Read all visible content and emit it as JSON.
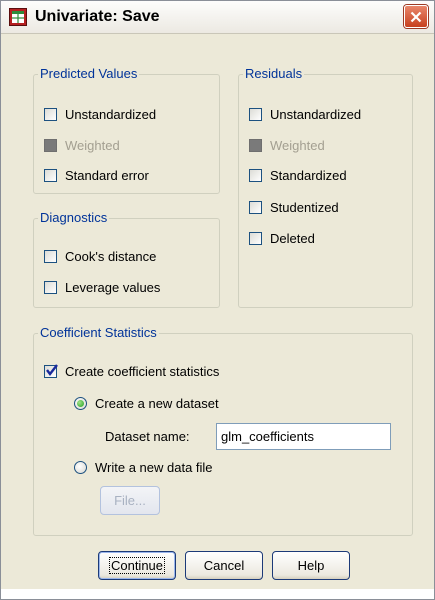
{
  "window": {
    "title": "Univariate: Save",
    "close_icon": "close-icon",
    "app_icon": "spss-table-icon"
  },
  "predicted_values": {
    "legend": "Predicted Values",
    "unstandardized": {
      "label": "Unstandardized",
      "checked": false,
      "enabled": true
    },
    "weighted": {
      "label": "Weighted",
      "checked": false,
      "enabled": false
    },
    "standard_error": {
      "label": "Standard error",
      "checked": false,
      "enabled": true
    }
  },
  "residuals": {
    "legend": "Residuals",
    "unstandardized": {
      "label": "Unstandardized",
      "checked": false,
      "enabled": true
    },
    "weighted": {
      "label": "Weighted",
      "checked": false,
      "enabled": false
    },
    "standardized": {
      "label": "Standardized",
      "checked": false,
      "enabled": true
    },
    "studentized": {
      "label": "Studentized",
      "checked": false,
      "enabled": true
    },
    "deleted": {
      "label": "Deleted",
      "checked": false,
      "enabled": true
    }
  },
  "diagnostics": {
    "legend": "Diagnostics",
    "cooks_distance": {
      "label": "Cook's distance",
      "checked": false,
      "enabled": true
    },
    "leverage_values": {
      "label": "Leverage values",
      "checked": false,
      "enabled": true
    }
  },
  "coefficient_statistics": {
    "legend": "Coefficient Statistics",
    "create_coefficient_statistics": {
      "label": "Create coefficient statistics",
      "checked": true
    },
    "create_new_dataset": {
      "label": "Create a new dataset",
      "selected": true
    },
    "dataset_name_label": "Dataset name:",
    "dataset_name_value": "glm_coefficients",
    "write_new_data_file": {
      "label": "Write a new data file",
      "selected": false
    },
    "file_button": "File..."
  },
  "buttons": {
    "continue": "Continue",
    "cancel": "Cancel",
    "help": "Help"
  },
  "colors": {
    "dialog_background": "#ece9d8",
    "group_legend": "#003399",
    "disabled_text": "#a39f91",
    "close_button": "#c7401f"
  }
}
